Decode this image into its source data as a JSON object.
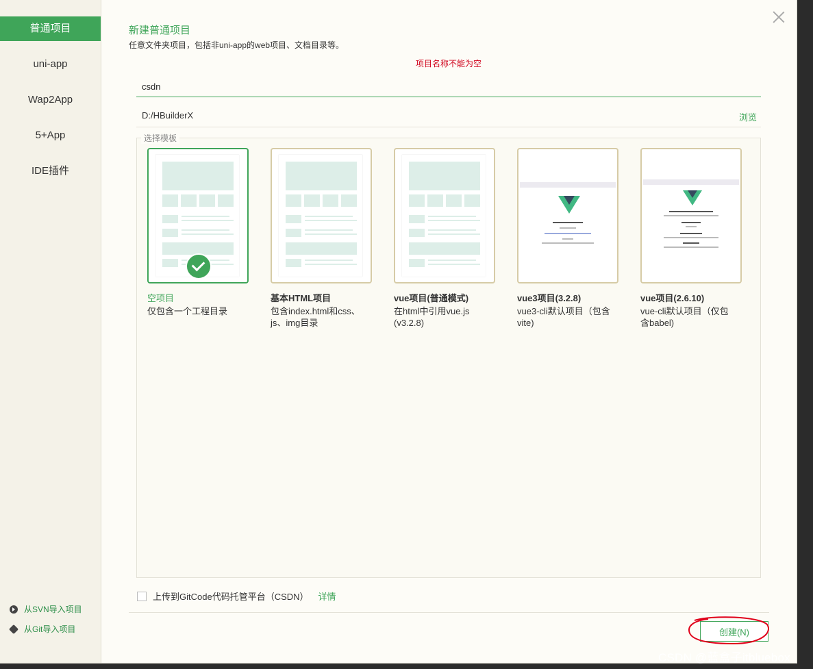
{
  "sidebar": {
    "items": [
      {
        "label": "普通项目",
        "active": true
      },
      {
        "label": "uni-app"
      },
      {
        "label": "Wap2App"
      },
      {
        "label": "5+App"
      },
      {
        "label": "IDE插件"
      }
    ],
    "links": [
      {
        "label": "从SVN导入项目",
        "icon": "svn-icon"
      },
      {
        "label": "从Git导入项目",
        "icon": "git-icon"
      }
    ]
  },
  "dialog": {
    "title": "新建普通项目",
    "subtitle": "任意文件夹项目，包括非uni-app的web项目、文档目录等。",
    "error": "项目名称不能为空",
    "name_value": "csdn",
    "path_value": "D:/HBuilderX",
    "browse_label": "浏览",
    "template_legend": "选择模板"
  },
  "templates": [
    {
      "title": "空项目",
      "desc": "仅包含一个工程目录",
      "selected": true
    },
    {
      "title": "基本HTML项目",
      "desc": "包含index.html和css、js、img目录"
    },
    {
      "title": "vue项目(普通模式)",
      "desc": "在html中引用vue.js (v3.2.8)"
    },
    {
      "title": "vue3项目(3.2.8)",
      "desc": "vue3-cli默认项目（包含vite)"
    },
    {
      "title": "vue项目(2.6.10)",
      "desc": "vue-cli默认项目（仅包含babel)"
    }
  ],
  "footer": {
    "upload_label": "上传到GitCode代码托管平台（CSDN）",
    "upload_checked": false,
    "details_label": "详情",
    "create_label": "创建(N)"
  },
  "watermark": "CSDN @蓝盒子itbluebox",
  "colors": {
    "accent": "#3fa559",
    "error": "#d0021b",
    "annotation": "#e0001a"
  }
}
